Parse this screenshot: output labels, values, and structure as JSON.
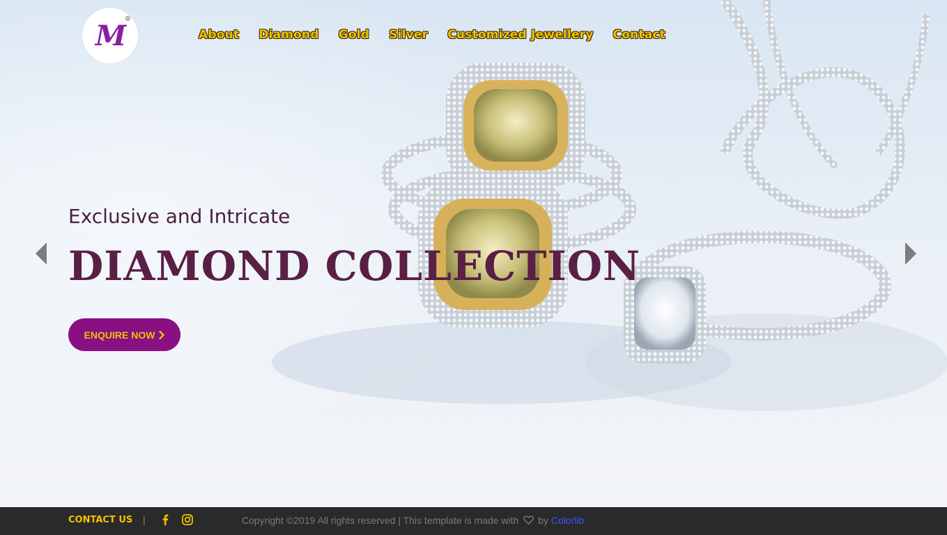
{
  "brand": {
    "logo_text": "M",
    "logo_alt": "NM jewellery logo"
  },
  "nav": {
    "items": [
      {
        "label": "About"
      },
      {
        "label": "Diamond"
      },
      {
        "label": "Gold"
      },
      {
        "label": "Silver"
      },
      {
        "label": "Customized Jewellery"
      },
      {
        "label": "Contact"
      }
    ]
  },
  "hero": {
    "subtitle": "Exclusive and Intricate",
    "title": "DIAMOND COLLECTION",
    "cta_label": "ENQUIRE NOW",
    "prev_icon": "triangle-left-icon",
    "next_icon": "triangle-right-icon"
  },
  "footer": {
    "contact_label": "CONTACT US",
    "separator": "|",
    "social": [
      "facebook-icon",
      "instagram-icon"
    ],
    "copyright_prefix": "Copyright ©2019 All rights reserved | This template is made with",
    "heart_icon": "heart-outline-icon",
    "by_text": "by",
    "credit_link": "Colorlib"
  },
  "colors": {
    "accent_yellow": "#f2c200",
    "brand_purple": "#8a0f83",
    "title_plum": "#5a1f45",
    "footer_bg": "#2a2a2a",
    "link_blue": "#3a55ff"
  }
}
